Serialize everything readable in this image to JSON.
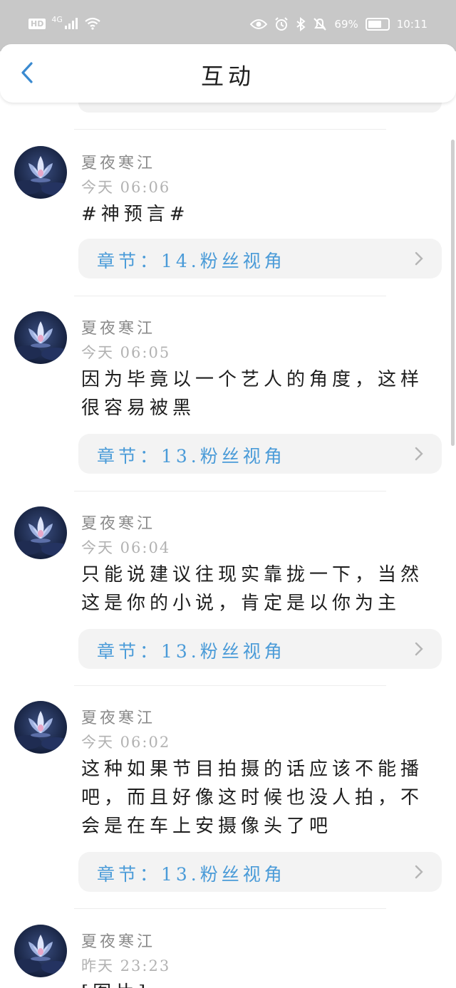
{
  "status_bar": {
    "network_badge": "HD",
    "network_type": "4G",
    "battery_percent": "69%",
    "battery_level": 0.69,
    "time": "10:11"
  },
  "header": {
    "title": "互动"
  },
  "items": [
    {
      "name": "夏夜寒江",
      "time": "今天 06:06",
      "lines": [
        "#神预言#"
      ],
      "chapter": "章节：14.粉丝视角"
    },
    {
      "name": "夏夜寒江",
      "time": "今天 06:05",
      "lines": [
        "因为毕竟以一个艺人的角度，这样",
        "很容易被黑"
      ],
      "chapter": "章节：13.粉丝视角"
    },
    {
      "name": "夏夜寒江",
      "time": "今天 06:04",
      "lines": [
        "只能说建议往现实靠拢一下，当然",
        "这是你的小说，肯定是以你为主"
      ],
      "chapter": "章节：13.粉丝视角"
    },
    {
      "name": "夏夜寒江",
      "time": "今天 06:02",
      "lines": [
        "这种如果节目拍摄的话应该不能播",
        "吧，而且好像这时候也没人拍，不",
        "会是在车上安摄像头了吧"
      ],
      "chapter": "章节：13.粉丝视角"
    },
    {
      "name": "夏夜寒江",
      "time": "昨天 23:23",
      "lines": [
        "[图片]"
      ],
      "chapter": ""
    }
  ],
  "colors": {
    "status_bar_bg": "#c8c8c8",
    "accent_blue": "#4a9bd8",
    "chip_bg": "#f3f3f3"
  }
}
